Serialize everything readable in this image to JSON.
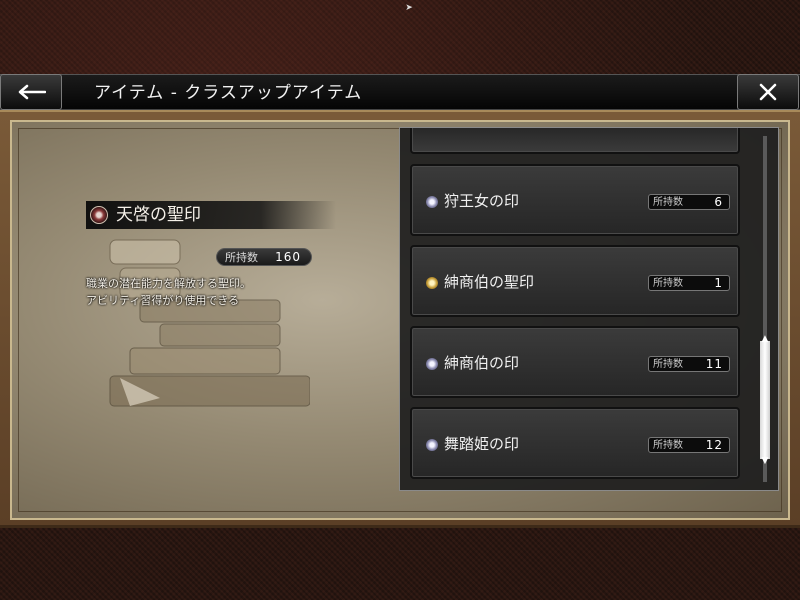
{
  "header": {
    "title": "アイテム - クラスアップアイテム"
  },
  "selected_item": {
    "name": "天啓の聖印",
    "owned_label": "所持数",
    "owned_value": "160",
    "description_line1": "職業の潜在能力を解放する聖印。",
    "description_line2": "アビリティ習得がり使用できる"
  },
  "list": {
    "items": [
      {
        "name": "狩王女の印",
        "count_label": "所持数",
        "count": "6",
        "icon": "silver-seal-icon"
      },
      {
        "name": "紳商伯の聖印",
        "count_label": "所持数",
        "count": "1",
        "icon": "gold-seal-icon"
      },
      {
        "name": "紳商伯の印",
        "count_label": "所持数",
        "count": "11",
        "icon": "silver-seal-icon"
      },
      {
        "name": "舞踏姫の印",
        "count_label": "所持数",
        "count": "12",
        "icon": "silver-seal-icon"
      }
    ]
  },
  "scrollbar": {
    "position_fraction": 0.9
  },
  "colors": {
    "background": "#2a1812",
    "header": "#0c0c0c",
    "frame": "#7a5a38",
    "parchment": "#a89d86",
    "list_panel": "#1e1e1e",
    "text": "#f0f0f0"
  }
}
